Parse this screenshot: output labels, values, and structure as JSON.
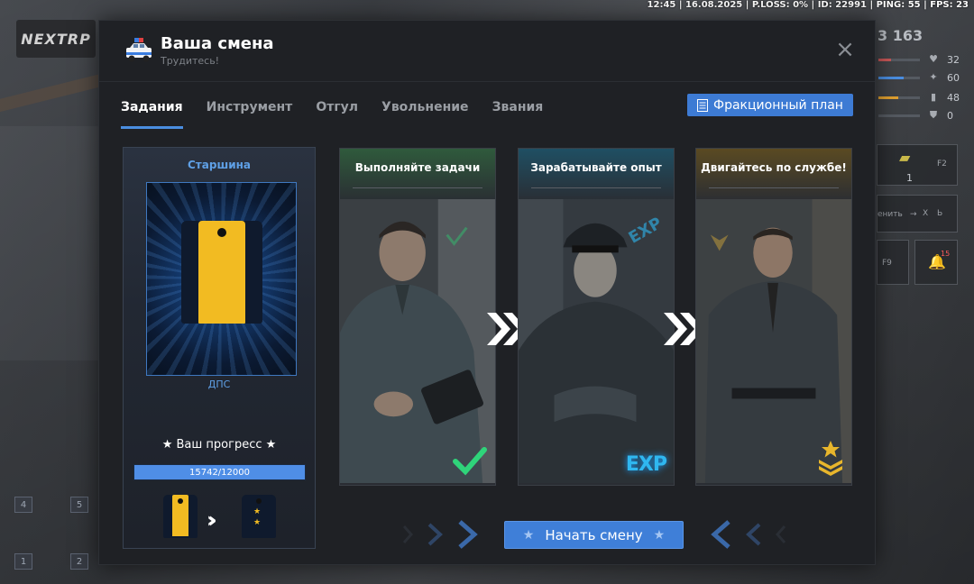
{
  "status_bar": {
    "text": "12:45 | 16.08.2025 | P.LOSS: 0% | ID: 22991 | PING: 55 | FPS: 23"
  },
  "background_hud": {
    "logo": "NEXTRP",
    "money": "3 163",
    "stats": [
      {
        "icon": "heart-icon",
        "value": "32",
        "color": "#c95757",
        "fill": 0.3
      },
      {
        "icon": "stamina-icon",
        "value": "60",
        "color": "#4a8ee0",
        "fill": 0.6
      },
      {
        "icon": "food-icon",
        "value": "48",
        "color": "#e0a030",
        "fill": 0.48
      },
      {
        "icon": "armor-icon",
        "value": "0",
        "color": "#8a8e94",
        "fill": 0
      }
    ],
    "slot_count": "1",
    "slot_key": "F2",
    "hint_text": "енить",
    "hint_keys": [
      "X",
      "Ь"
    ],
    "key_f9": "F9",
    "notification_count": "15",
    "hotbar_numbers": [
      "4",
      "5",
      "1",
      "2"
    ]
  },
  "window": {
    "title": "Ваша смена",
    "subtitle": "Трудитесь!",
    "close_label": "×",
    "tabs": [
      {
        "label": "Задания",
        "active": true
      },
      {
        "label": "Инструмент",
        "active": false
      },
      {
        "label": "Отгул",
        "active": false
      },
      {
        "label": "Увольнение",
        "active": false
      },
      {
        "label": "Звания",
        "active": false
      }
    ],
    "plan_button": "Фракционный план"
  },
  "rank_panel": {
    "rank_name": "Старшина",
    "division": "ДПС",
    "progress_label": "★ Ваш прогресс ★",
    "progress_current": 15742,
    "progress_max": 12000,
    "progress_text": "15742/12000",
    "progress_fill": 1.0,
    "current_rank_stars": 0,
    "next_rank_stars": 2
  },
  "steps": [
    {
      "title": "Выполняйте задачи",
      "accent": "#2fbf70",
      "badge": "checkmark-icon"
    },
    {
      "title": "Зарабатывайте опыт",
      "accent": "#2fa6d8",
      "badge": "exp-icon",
      "badge_text": "EXP"
    },
    {
      "title": "Двигайтесь по службе!",
      "accent": "#c9a23a",
      "badge": "rank-chevron-icon"
    }
  ],
  "start_button": "Начать смену",
  "colors": {
    "accent": "#3f7fd8",
    "window_bg": "#1f2125",
    "rank_gold": "#f2bb22"
  }
}
